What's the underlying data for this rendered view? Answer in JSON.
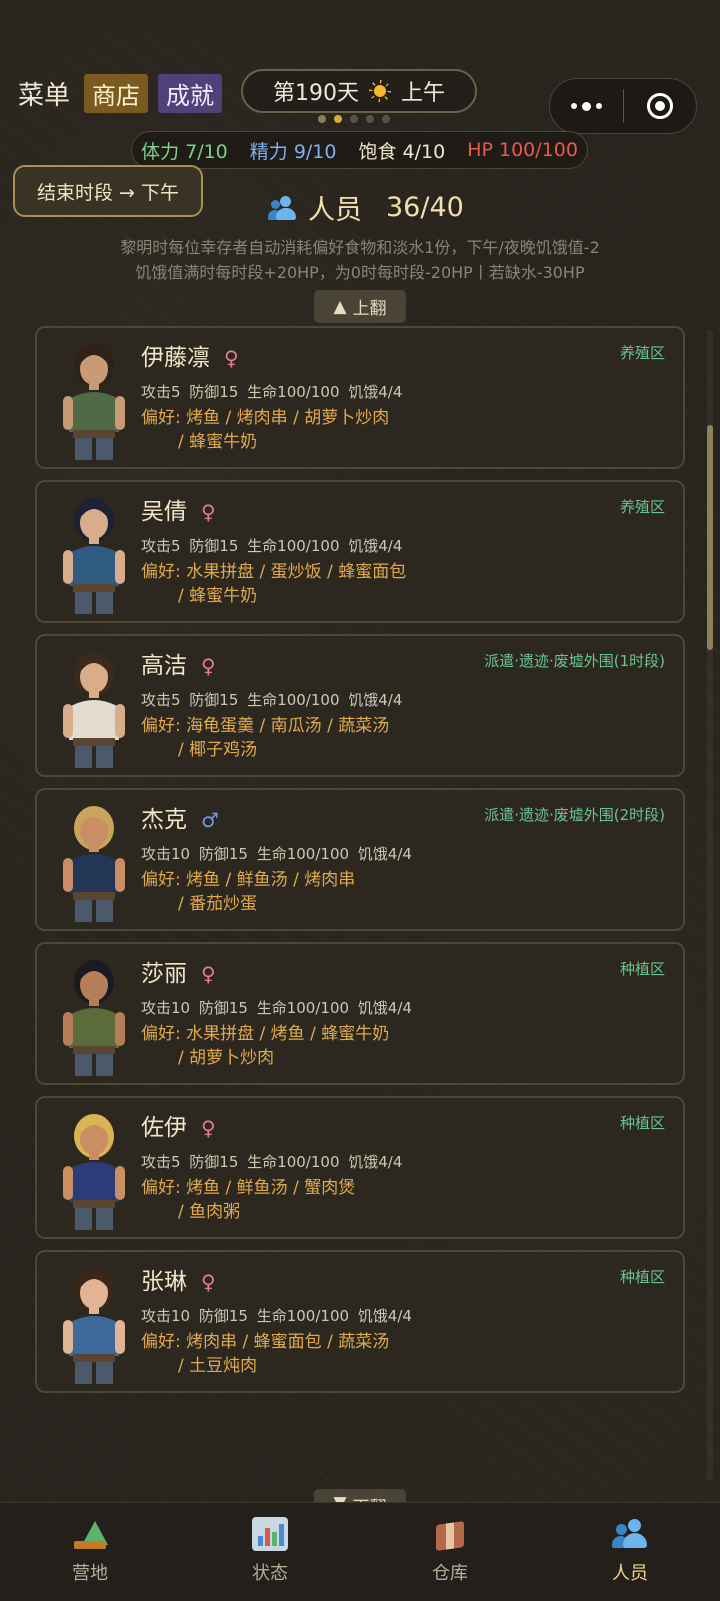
{
  "header": {
    "menu": "菜单",
    "shop": "商店",
    "achievements": "成就",
    "day": "第190天",
    "period": "上午"
  },
  "stats": {
    "stamina": "体力 7/10",
    "spirit": "精力 9/10",
    "satiety": "饱食 4/10",
    "hp": "HP 100/100"
  },
  "end_button": "结束时段 → 下午",
  "people": {
    "title": "人员",
    "count": "36/40",
    "rules_line1": "黎明时每位幸存者自动消耗偏好食物和淡水1份，下午/夜晚饥饿值-2",
    "rules_line2": "饥饿值满时每时段+20HP，为0时每时段-20HP丨若缺水-30HP",
    "page_up": "上翻",
    "page_down": "下翻"
  },
  "members": [
    {
      "name": "伊藤凛",
      "gender": "♀",
      "assign": "养殖区",
      "attrs": "攻击5 防御15 生命100/100 饥饿4/4",
      "prefs1": "偏好: 烤鱼 / 烤肉串 / 胡萝卜炒肉",
      "prefs2": "/ 蜂蜜牛奶",
      "hair": "#2e2218",
      "shirt": "#4f6a45",
      "skin": "#c99a76"
    },
    {
      "name": "吴倩",
      "gender": "♀",
      "assign": "养殖区",
      "attrs": "攻击5 防御15 生命100/100 饥饿4/4",
      "prefs1": "偏好: 水果拼盘 / 蛋炒饭 / 蜂蜜面包",
      "prefs2": "/ 蜂蜜牛奶",
      "hair": "#1c2233",
      "shirt": "#2f5a82",
      "skin": "#d9ad8c"
    },
    {
      "name": "高洁",
      "gender": "♀",
      "assign": "派遣·遗迹·废墟外围(1时段)",
      "attrs": "攻击5 防御15 生命100/100 饥饿4/4",
      "prefs1": "偏好: 海龟蛋羹 / 南瓜汤 / 蔬菜汤",
      "prefs2": "/ 椰子鸡汤",
      "hair": "#3b2a1c",
      "shirt": "#e2ddd0",
      "skin": "#d8ad8a"
    },
    {
      "name": "杰克",
      "gender": "♂",
      "assign": "派遣·遗迹·废墟外围(2时段)",
      "attrs": "攻击10 防御15 生命100/100 饥饿4/4",
      "prefs1": "偏好: 烤鱼 / 鲜鱼汤 / 烤肉串",
      "prefs2": "/ 番茄炒蛋",
      "hair": "#c9a45a",
      "shirt": "#243656",
      "skin": "#c98e66"
    },
    {
      "name": "莎丽",
      "gender": "♀",
      "assign": "种植区",
      "attrs": "攻击10 防御15 生命100/100 饥饿4/4",
      "prefs1": "偏好: 水果拼盘 / 烤鱼 / 蜂蜜牛奶",
      "prefs2": "/ 胡萝卜炒肉",
      "hair": "#1a1a22",
      "shirt": "#5c6b3a",
      "skin": "#b57d58"
    },
    {
      "name": "佐伊",
      "gender": "♀",
      "assign": "种植区",
      "attrs": "攻击5 防御15 生命100/100 饥饿4/4",
      "prefs1": "偏好: 烤鱼 / 鲜鱼汤 / 蟹肉煲",
      "prefs2": "/ 鱼肉粥",
      "hair": "#d9b450",
      "shirt": "#2a3d78",
      "skin": "#c98e62"
    },
    {
      "name": "张琳",
      "gender": "♀",
      "assign": "种植区",
      "attrs": "攻击10 防御15 生命100/100 饥饿4/4",
      "prefs1": "偏好: 烤肉串 / 蜂蜜面包 / 蔬菜汤",
      "prefs2": "/ 土豆炖肉",
      "hair": "#3a2618",
      "shirt": "#3d6a9a",
      "skin": "#e0b494"
    }
  ],
  "tabs": [
    {
      "label": "营地",
      "icon": "camp-icon"
    },
    {
      "label": "状态",
      "icon": "status-chart-icon"
    },
    {
      "label": "仓库",
      "icon": "warehouse-box-icon"
    },
    {
      "label": "人员",
      "icon": "people-icon"
    }
  ]
}
